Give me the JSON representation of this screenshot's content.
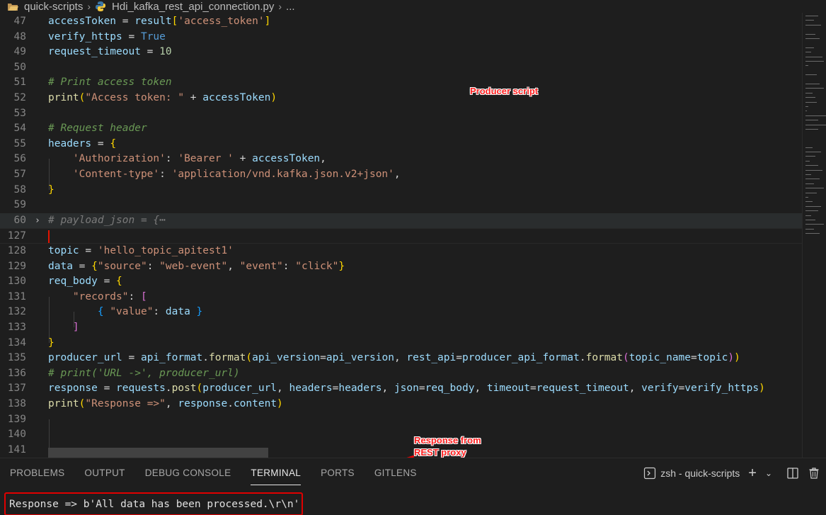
{
  "breadcrumb": {
    "folder": "quick-scripts",
    "file": "Hdi_kafka_rest_api_connection.py",
    "more": "..."
  },
  "editor": {
    "lines": [
      {
        "no": "47",
        "tokens": [
          [
            "v",
            "accessToken"
          ],
          [
            "o",
            " = "
          ],
          [
            "v",
            "result"
          ],
          [
            "b1",
            "["
          ],
          [
            "s",
            "'access_token'"
          ],
          [
            "b1",
            "]"
          ]
        ]
      },
      {
        "no": "48",
        "tokens": [
          [
            "v",
            "verify_https"
          ],
          [
            "o",
            " = "
          ],
          [
            "k",
            "True"
          ]
        ]
      },
      {
        "no": "49",
        "tokens": [
          [
            "v",
            "request_timeout"
          ],
          [
            "o",
            " = "
          ],
          [
            "n",
            "10"
          ]
        ]
      },
      {
        "no": "50",
        "tokens": []
      },
      {
        "no": "51",
        "tokens": [
          [
            "c",
            "# Print access token"
          ]
        ]
      },
      {
        "no": "52",
        "tokens": [
          [
            "f",
            "print"
          ],
          [
            "b1",
            "("
          ],
          [
            "s",
            "\"Access token: \""
          ],
          [
            "o",
            " + "
          ],
          [
            "v",
            "accessToken"
          ],
          [
            "b1",
            ")"
          ]
        ]
      },
      {
        "no": "53",
        "tokens": []
      },
      {
        "no": "54",
        "tokens": [
          [
            "c",
            "# Request header"
          ]
        ]
      },
      {
        "no": "55",
        "tokens": [
          [
            "v",
            "headers"
          ],
          [
            "o",
            " = "
          ],
          [
            "b1",
            "{"
          ]
        ]
      },
      {
        "no": "56",
        "tokens": [
          [
            "o",
            "    "
          ],
          [
            "s",
            "'Authorization'"
          ],
          [
            "o",
            ": "
          ],
          [
            "s",
            "'Bearer '"
          ],
          [
            "o",
            " + "
          ],
          [
            "v",
            "accessToken"
          ],
          [
            "o",
            ","
          ]
        ]
      },
      {
        "no": "57",
        "tokens": [
          [
            "o",
            "    "
          ],
          [
            "s",
            "'Content-type'"
          ],
          [
            "o",
            ": "
          ],
          [
            "s",
            "'application/vnd.kafka.json.v2+json'"
          ],
          [
            "o",
            ","
          ]
        ]
      },
      {
        "no": "58",
        "tokens": [
          [
            "b1",
            "}"
          ]
        ]
      },
      {
        "no": "59",
        "tokens": []
      },
      {
        "no": "60",
        "tokens": [
          [
            "cf",
            "# payload_json = {"
          ],
          [
            "foldmark",
            "⋯"
          ]
        ]
      },
      {
        "no": "127",
        "tokens": []
      },
      {
        "no": "128",
        "tokens": [
          [
            "v",
            "topic"
          ],
          [
            "o",
            " = "
          ],
          [
            "s",
            "'hello_topic_apitest1'"
          ]
        ]
      },
      {
        "no": "129",
        "tokens": [
          [
            "v",
            "data"
          ],
          [
            "o",
            " = "
          ],
          [
            "b1",
            "{"
          ],
          [
            "s",
            "\"source\""
          ],
          [
            "o",
            ": "
          ],
          [
            "s",
            "\"web-event\""
          ],
          [
            "o",
            ", "
          ],
          [
            "s",
            "\"event\""
          ],
          [
            "o",
            ": "
          ],
          [
            "s",
            "\"click\""
          ],
          [
            "b1",
            "}"
          ]
        ]
      },
      {
        "no": "130",
        "tokens": [
          [
            "v",
            "req_body"
          ],
          [
            "o",
            " = "
          ],
          [
            "b1",
            "{"
          ]
        ]
      },
      {
        "no": "131",
        "tokens": [
          [
            "o",
            "    "
          ],
          [
            "s",
            "\"records\""
          ],
          [
            "o",
            ": "
          ],
          [
            "b2",
            "["
          ]
        ]
      },
      {
        "no": "132",
        "tokens": [
          [
            "o",
            "        "
          ],
          [
            "b3",
            "{"
          ],
          [
            "o",
            " "
          ],
          [
            "s",
            "\"value\""
          ],
          [
            "o",
            ": "
          ],
          [
            "v",
            "data"
          ],
          [
            "o",
            " "
          ],
          [
            "b3",
            "}"
          ]
        ]
      },
      {
        "no": "133",
        "tokens": [
          [
            "o",
            "    "
          ],
          [
            "b2",
            "]"
          ]
        ]
      },
      {
        "no": "134",
        "tokens": [
          [
            "b1",
            "}"
          ]
        ]
      },
      {
        "no": "135",
        "tokens": [
          [
            "v",
            "producer_url"
          ],
          [
            "o",
            " = "
          ],
          [
            "v",
            "api_format"
          ],
          [
            "o",
            "."
          ],
          [
            "f",
            "format"
          ],
          [
            "b1",
            "("
          ],
          [
            "v",
            "api_version"
          ],
          [
            "o",
            "="
          ],
          [
            "v",
            "api_version"
          ],
          [
            "o",
            ", "
          ],
          [
            "v",
            "rest_api"
          ],
          [
            "o",
            "="
          ],
          [
            "v",
            "producer_api_format"
          ],
          [
            "o",
            "."
          ],
          [
            "f",
            "format"
          ],
          [
            "b2",
            "("
          ],
          [
            "v",
            "topic_name"
          ],
          [
            "o",
            "="
          ],
          [
            "v",
            "topic"
          ],
          [
            "b2",
            ")"
          ],
          [
            "b1",
            ")"
          ]
        ]
      },
      {
        "no": "136",
        "tokens": [
          [
            "c",
            "# print('URL ->', producer_url)"
          ]
        ]
      },
      {
        "no": "137",
        "tokens": [
          [
            "v",
            "response"
          ],
          [
            "o",
            " = "
          ],
          [
            "v",
            "requests"
          ],
          [
            "o",
            "."
          ],
          [
            "f",
            "post"
          ],
          [
            "b1",
            "("
          ],
          [
            "v",
            "producer_url"
          ],
          [
            "o",
            ", "
          ],
          [
            "v",
            "headers"
          ],
          [
            "o",
            "="
          ],
          [
            "v",
            "headers"
          ],
          [
            "o",
            ", "
          ],
          [
            "v",
            "json"
          ],
          [
            "o",
            "="
          ],
          [
            "v",
            "req_body"
          ],
          [
            "o",
            ", "
          ],
          [
            "v",
            "timeout"
          ],
          [
            "o",
            "="
          ],
          [
            "v",
            "request_timeout"
          ],
          [
            "o",
            ", "
          ],
          [
            "v",
            "verify"
          ],
          [
            "o",
            "="
          ],
          [
            "v",
            "verify_https"
          ],
          [
            "b1",
            ")"
          ]
        ]
      },
      {
        "no": "138",
        "tokens": [
          [
            "f",
            "print"
          ],
          [
            "b1",
            "("
          ],
          [
            "s",
            "\"Response =>\""
          ],
          [
            "o",
            ", "
          ],
          [
            "v",
            "response"
          ],
          [
            "o",
            "."
          ],
          [
            "v",
            "content"
          ],
          [
            "b1",
            ")"
          ]
        ]
      },
      {
        "no": "139",
        "tokens": []
      },
      {
        "no": "140",
        "tokens": []
      },
      {
        "no": "141",
        "tokens": []
      }
    ]
  },
  "annotations": {
    "producer": "Producer script",
    "response": "Response from\nREST proxy\nproducer  request"
  },
  "panel": {
    "tabs": [
      "PROBLEMS",
      "OUTPUT",
      "DEBUG CONSOLE",
      "TERMINAL",
      "PORTS",
      "GITLENS"
    ],
    "active_tab": "TERMINAL",
    "terminal_name": "zsh - quick-scripts",
    "output": "Response => b'All data has been processed.\\r\\n'"
  },
  "colors": {
    "annotation": "#ff2020",
    "cursor": "#e51400",
    "box": "#e00000"
  },
  "icons": [
    "folder-icon",
    "python-file-icon",
    "terminal-icon",
    "plus-icon",
    "chevron-down-icon",
    "split-icon",
    "trash-icon",
    "fold-chevron-icon"
  ]
}
